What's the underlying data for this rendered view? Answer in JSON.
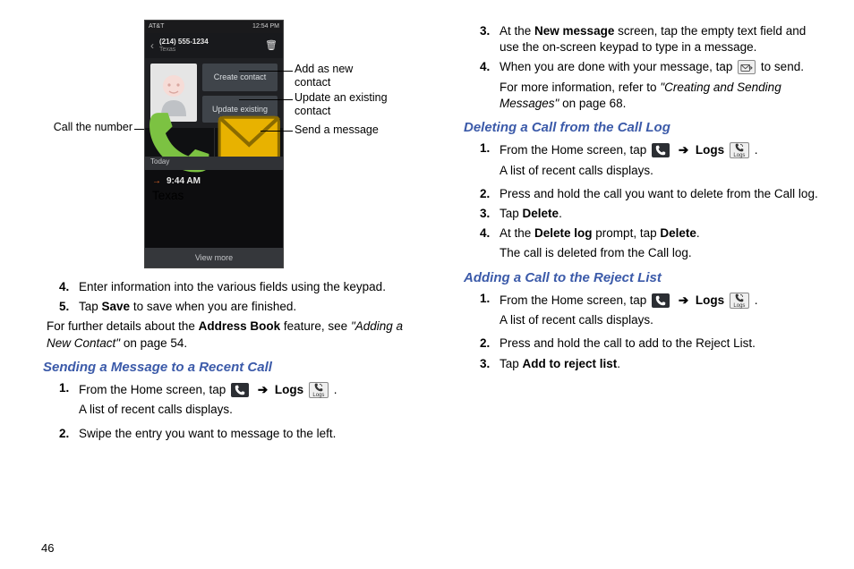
{
  "page_number": "46",
  "callouts": {
    "call_number": "Call the number",
    "add_new_l1": "Add as new",
    "add_new_l2": "contact",
    "update_l1": "Update an existing",
    "update_l2": "contact",
    "send_msg": "Send a message"
  },
  "phone": {
    "carrier": "AT&T",
    "time": "12:54 PM",
    "number": "(214) 555-1234",
    "location": "Texas",
    "btn_create": "Create contact",
    "btn_update": "Update existing",
    "today": "Today",
    "log_time": "9:44 AM",
    "log_location": "Texas",
    "view_more": "View more"
  },
  "left": {
    "step4": "Enter information into the various fields using the keypad.",
    "step5_pre": "Tap ",
    "step5_b": "Save",
    "step5_post": " to save when you are finished.",
    "further_pre": "For further details about the ",
    "further_b": "Address Book",
    "further_mid": " feature, see ",
    "further_ital": "\"Adding a New Contact\"",
    "further_post": " on page 54.",
    "heading_send": "Sending a Message to a Recent Call",
    "send1_pre": "From the Home screen, tap ",
    "send1_logs": "Logs",
    "send1_post": " .",
    "send1_sub": "A list of recent calls displays.",
    "send2": "Swipe the entry you want to message to the left."
  },
  "right": {
    "step3_pre": "At the ",
    "step3_b": "New message",
    "step3_post": " screen, tap the empty text field and use the on-screen keypad to type in a message.",
    "step4_pre": "When you are done with your message, tap ",
    "step4_post": " to send.",
    "step4_more_pre": "For more information, refer to ",
    "step4_more_ital": "\"Creating and Sending Messages\"",
    "step4_more_post": "  on page 68.",
    "heading_delete": "Deleting a Call from the Call Log",
    "del1_pre": "From the Home screen, tap ",
    "del1_logs": "Logs",
    "del1_post": " .",
    "del1_sub": "A list of recent calls displays.",
    "del2": "Press and hold the call you want to delete from the Call log.",
    "del3_pre": "Tap ",
    "del3_b": "Delete",
    "del3_post": ".",
    "del4_pre": "At the ",
    "del4_b1": "Delete log",
    "del4_mid": " prompt, tap ",
    "del4_b2": "Delete",
    "del4_post": ".",
    "del4_sub": "The call is deleted from the Call log.",
    "heading_reject": "Adding a Call to the Reject List",
    "rej1_pre": "From the Home screen, tap ",
    "rej1_logs": "Logs",
    "rej1_post": " .",
    "rej1_sub": "A list of recent calls displays.",
    "rej2": "Press and hold the call to add to the Reject List.",
    "rej3_pre": "Tap ",
    "rej3_b": "Add to reject list",
    "rej3_post": "."
  },
  "common": {
    "arrow": "➔",
    "logs_label": "Logs"
  }
}
